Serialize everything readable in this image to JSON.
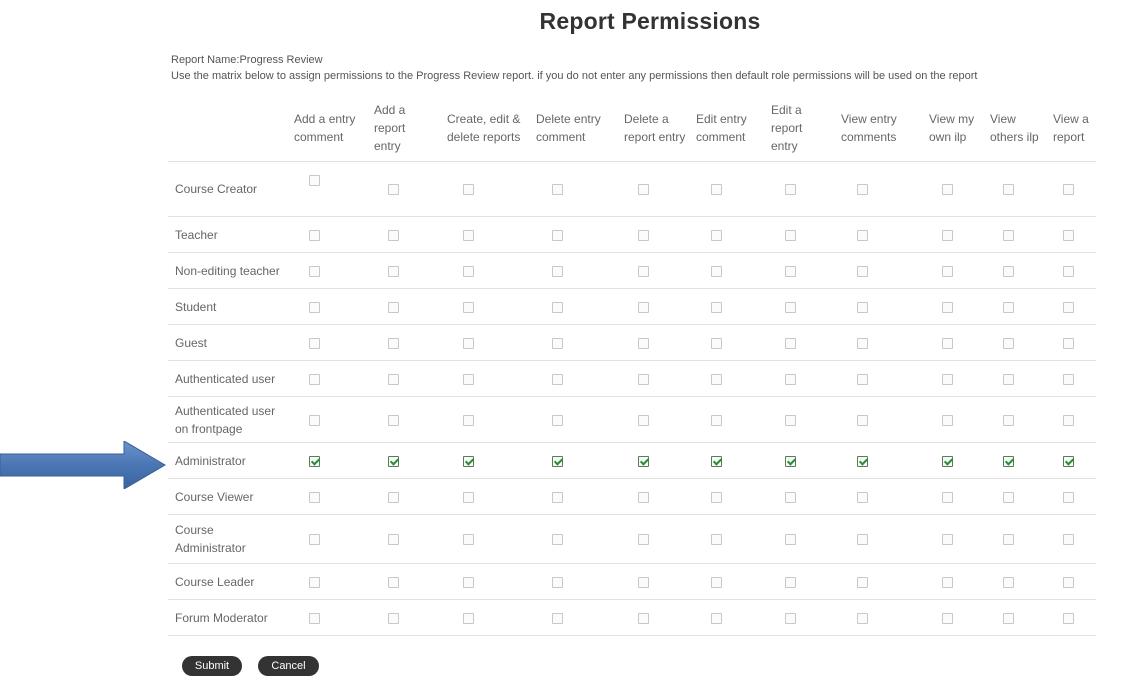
{
  "page": {
    "title": "Report Permissions",
    "report_name": "Report Name:Progress Review",
    "instructions": "Use the matrix below to assign permissions to the Progress Review report. if you do not enter any permissions then default role permissions will be used on the report"
  },
  "columns": [
    {
      "label": "Add a entry comment"
    },
    {
      "label": "Add a report entry"
    },
    {
      "label": "Create, edit & delete reports"
    },
    {
      "label": "Delete entry comment"
    },
    {
      "label": "Delete a report entry"
    },
    {
      "label": "Edit entry comment"
    },
    {
      "label": "Edit a report entry"
    },
    {
      "label": "View entry comments"
    },
    {
      "label": "View my own ilp"
    },
    {
      "label": "View others ilp"
    },
    {
      "label": "View a report"
    }
  ],
  "rows": [
    {
      "role": "Course Creator",
      "checked": [
        false,
        false,
        false,
        false,
        false,
        false,
        false,
        false,
        false,
        false,
        false
      ]
    },
    {
      "role": "Teacher",
      "checked": [
        false,
        false,
        false,
        false,
        false,
        false,
        false,
        false,
        false,
        false,
        false
      ]
    },
    {
      "role": "Non-editing teacher",
      "checked": [
        false,
        false,
        false,
        false,
        false,
        false,
        false,
        false,
        false,
        false,
        false
      ]
    },
    {
      "role": "Student",
      "checked": [
        false,
        false,
        false,
        false,
        false,
        false,
        false,
        false,
        false,
        false,
        false
      ]
    },
    {
      "role": "Guest",
      "checked": [
        false,
        false,
        false,
        false,
        false,
        false,
        false,
        false,
        false,
        false,
        false
      ]
    },
    {
      "role": "Authenticated user",
      "checked": [
        false,
        false,
        false,
        false,
        false,
        false,
        false,
        false,
        false,
        false,
        false
      ]
    },
    {
      "role": "Authenticated user on frontpage",
      "checked": [
        false,
        false,
        false,
        false,
        false,
        false,
        false,
        false,
        false,
        false,
        false
      ]
    },
    {
      "role": "Administrator",
      "checked": [
        true,
        true,
        true,
        true,
        true,
        true,
        true,
        true,
        true,
        true,
        true
      ]
    },
    {
      "role": "Course Viewer",
      "checked": [
        false,
        false,
        false,
        false,
        false,
        false,
        false,
        false,
        false,
        false,
        false
      ]
    },
    {
      "role": "Course Administrator",
      "checked": [
        false,
        false,
        false,
        false,
        false,
        false,
        false,
        false,
        false,
        false,
        false
      ]
    },
    {
      "role": "Course Leader",
      "checked": [
        false,
        false,
        false,
        false,
        false,
        false,
        false,
        false,
        false,
        false,
        false
      ]
    },
    {
      "role": "Forum Moderator",
      "checked": [
        false,
        false,
        false,
        false,
        false,
        false,
        false,
        false,
        false,
        false,
        false
      ]
    }
  ],
  "buttons": {
    "submit": "Submit",
    "cancel": "Cancel"
  },
  "annotation": {
    "arrow_icon": "right-arrow-icon",
    "arrow_color": "#4a76b4",
    "points_to_role": "Administrator"
  },
  "colors": {
    "check_color": "#2e8b3d",
    "button_bg": "#333333"
  }
}
